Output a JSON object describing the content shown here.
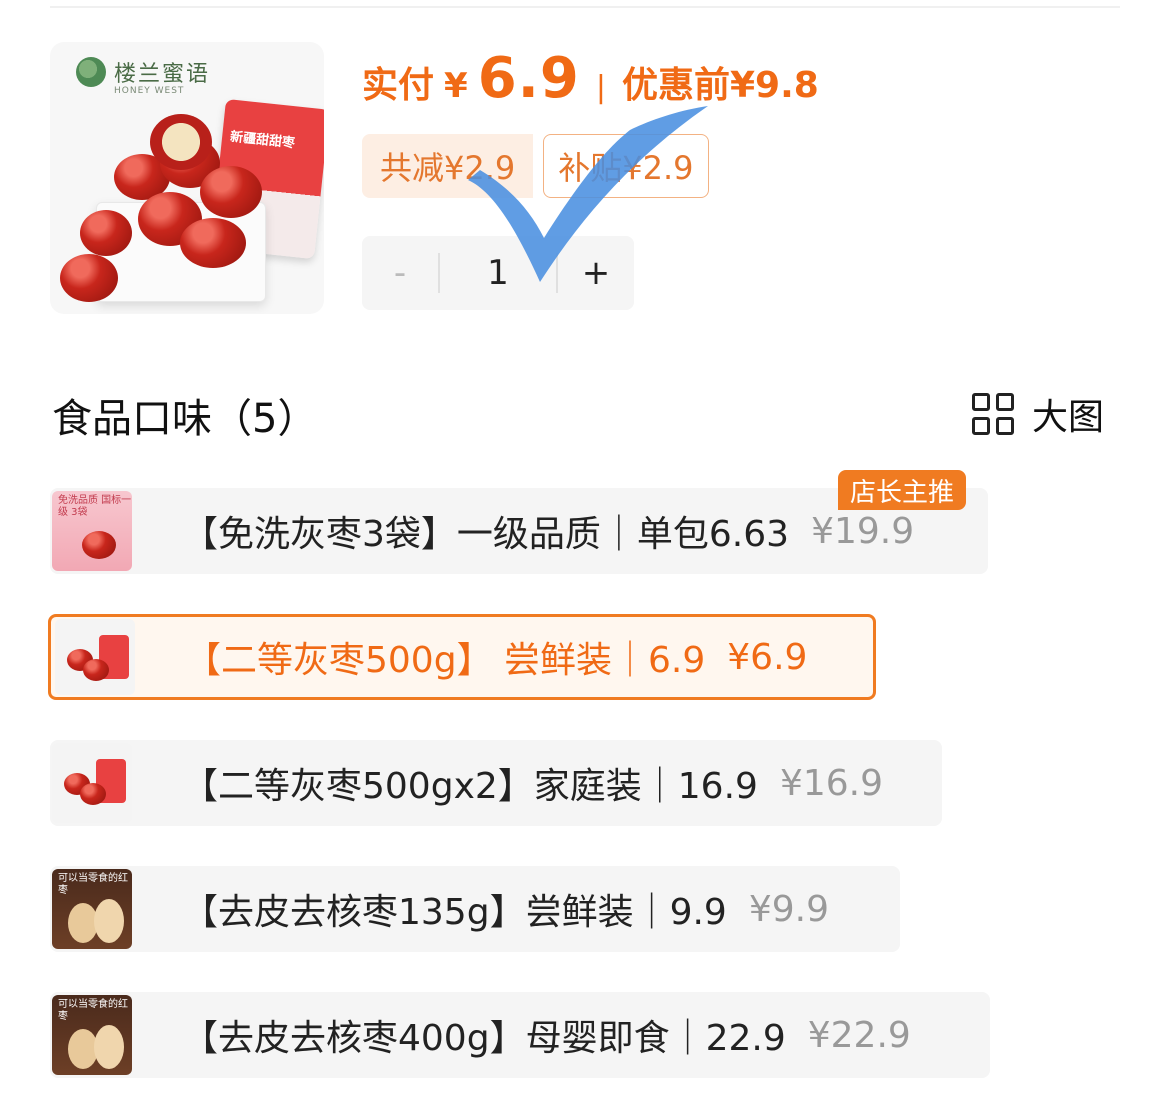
{
  "product": {
    "brand_name": "楼兰蜜语",
    "brand_sub": "HONEY WEST",
    "bag_label": "新疆甜甜枣"
  },
  "price": {
    "paid_label": "实付",
    "currency": "¥",
    "paid_value": "6.9",
    "separator": "|",
    "original": "优惠前¥9.8"
  },
  "discount": {
    "total": "共减¥2.9",
    "subsidy": "补贴¥2.9"
  },
  "stepper": {
    "minus": "-",
    "value": "1",
    "plus": "+"
  },
  "section": {
    "title": "食品口味（5）",
    "view_label": "大图"
  },
  "badge": "店长主推",
  "options": [
    {
      "name": "【免洗灰枣3袋】一级品质｜单包6.63",
      "price": "¥19.9",
      "thumb_text": "免洗品质 国标一级 3袋"
    },
    {
      "name": "【二等灰枣500g】 尝鲜装｜6.9",
      "price": "¥6.9",
      "thumb_text": ""
    },
    {
      "name": "【二等灰枣500gx2】家庭装｜16.9",
      "price": "¥16.9",
      "thumb_text": ""
    },
    {
      "name": "【去皮去核枣135g】尝鲜装｜9.9",
      "price": "¥9.9",
      "thumb_text": "可以当零食的红枣"
    },
    {
      "name": "【去皮去核枣400g】母婴即食｜22.9",
      "price": "¥22.9",
      "thumb_text": "可以当零食的红枣"
    }
  ],
  "colors": {
    "accent": "#f06a15",
    "selected_border": "#f07b21",
    "checkmark": "#4a8fe0"
  }
}
